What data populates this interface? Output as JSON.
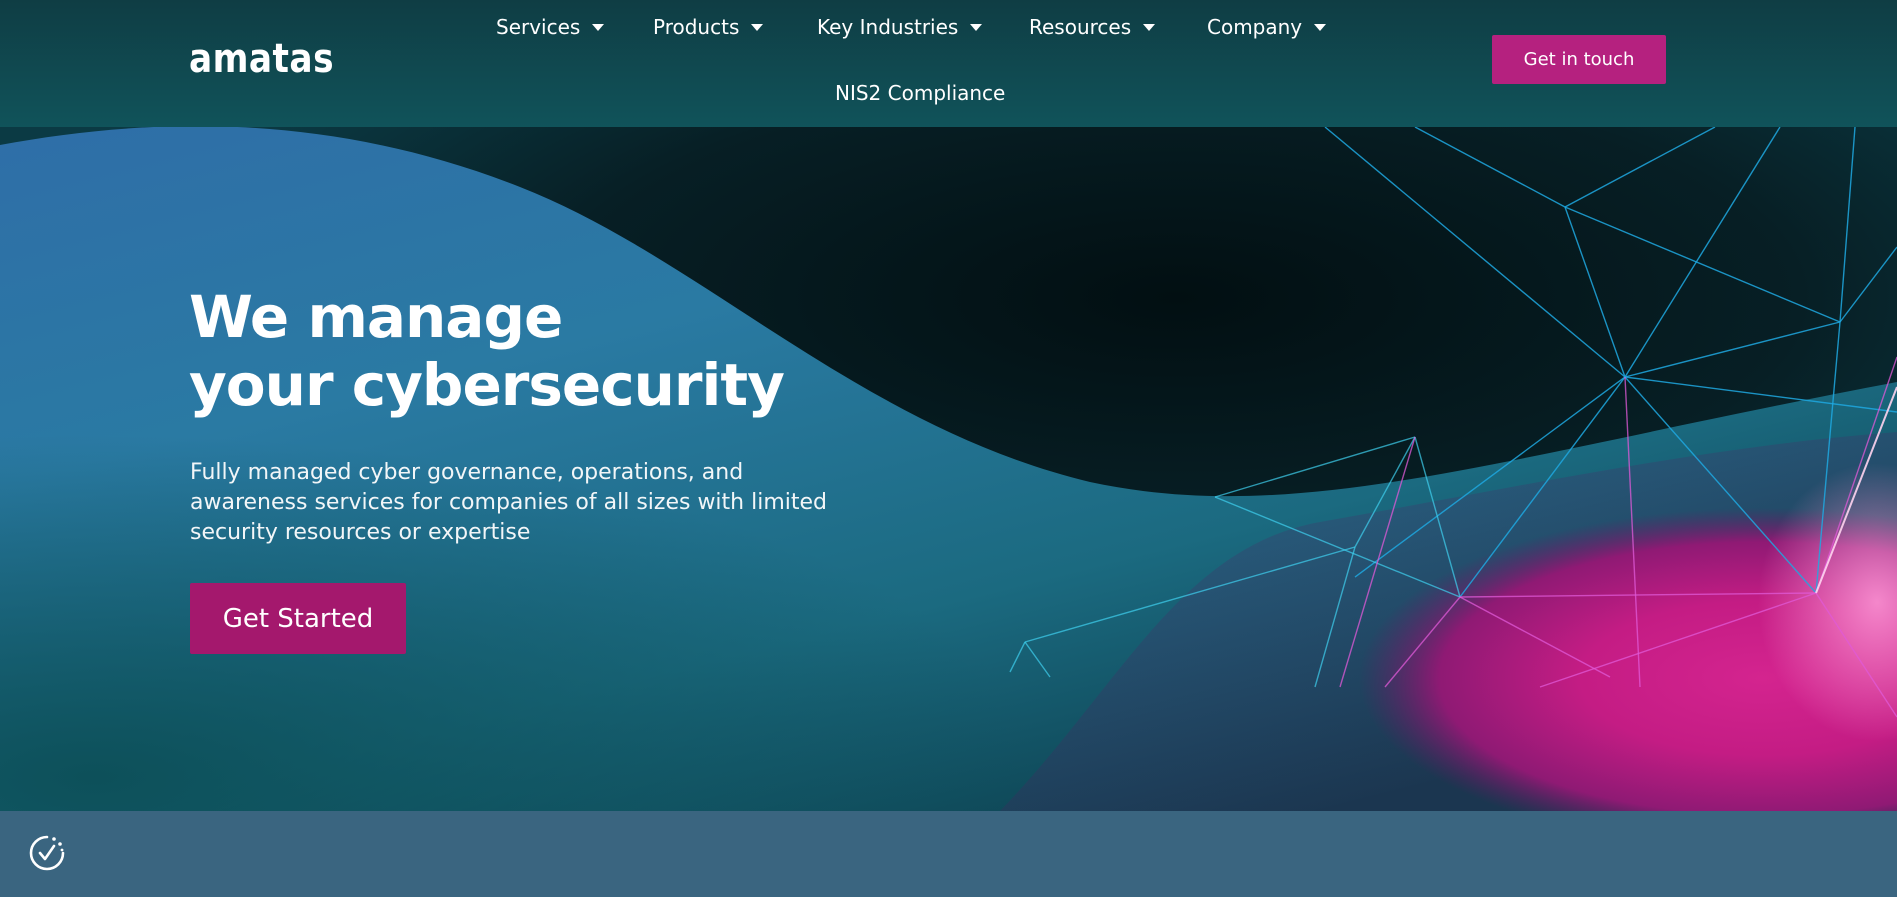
{
  "header": {
    "logo_text": "amatas",
    "nav": [
      {
        "label": "Services"
      },
      {
        "label": "Products"
      },
      {
        "label": "Key Industries"
      },
      {
        "label": "Resources"
      },
      {
        "label": "Company"
      }
    ],
    "nav_secondary": "NIS2 Compliance",
    "cta_label": "Get in touch"
  },
  "hero": {
    "title_line1": "We manage",
    "title_line2": "your cybersecurity",
    "subtitle_line1": "Fully managed cyber governance, operations, and",
    "subtitle_line2": "awareness services for companies of all sizes with limited",
    "subtitle_line3": "security resources or expertise",
    "cta_label": "Get Started"
  },
  "icons": {
    "cookie_settings": "cookie-consent-check-icon",
    "dropdown": "chevron-down-icon"
  },
  "colors": {
    "header_bg": "#10535a",
    "brand_magenta": "#b5217f",
    "hero_cta": "#a4186d",
    "bottom_bar": "#3a6580"
  }
}
